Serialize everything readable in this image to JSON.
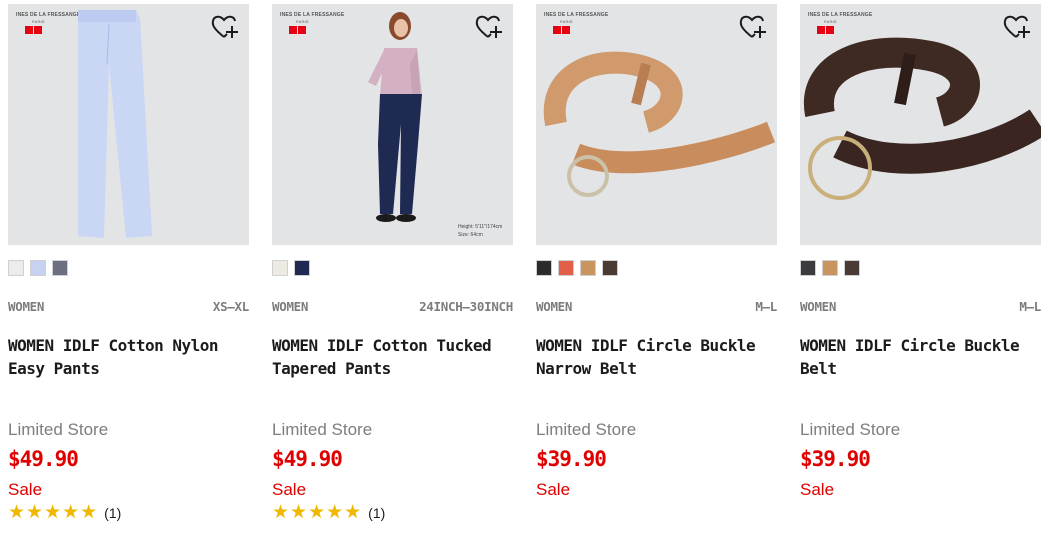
{
  "products": [
    {
      "brand_lines": [
        "INES DE LA FRESSANGE",
        "PARIS"
      ],
      "colors": [
        "#ececea",
        "#c6d2f0",
        "#6b6f80"
      ],
      "category": "WOMEN",
      "size": "XS–XL",
      "name": "WOMEN IDLF Cotton Nylon Easy Pants",
      "store": "Limited Store",
      "price": "$49.90",
      "sale": "Sale",
      "stars": "★★★★★",
      "reviews": "(1)",
      "image": "pants-blue"
    },
    {
      "brand_lines": [
        "INES DE LA FRESSANGE",
        "PARIS"
      ],
      "colors": [
        "#ede9e3",
        "#1e2a52"
      ],
      "category": "WOMEN",
      "size": "24INCH–30INCH",
      "name": "WOMEN IDLF Cotton Tucked Tapered Pants",
      "store": "Limited Store",
      "price": "$49.90",
      "sale": "Sale",
      "stars": "★★★★★",
      "reviews": "(1)",
      "image": "model-navy-pants",
      "model_note": [
        "Height: 5'11\"/174cm",
        "Size: 64cm"
      ]
    },
    {
      "brand_lines": [
        "INES DE LA FRESSANGE",
        "PARIS"
      ],
      "colors": [
        "#2b2b2b",
        "#e2604a",
        "#c8955f",
        "#4a3a34"
      ],
      "category": "WOMEN",
      "size": "M–L",
      "name": "WOMEN IDLF Circle Buckle Narrow Belt",
      "store": "Limited Store",
      "price": "$39.90",
      "sale": "Sale",
      "image": "belt-tan"
    },
    {
      "brand_lines": [
        "INES DE LA FRESSANGE",
        "PARIS"
      ],
      "colors": [
        "#3b3a3c",
        "#c8955f",
        "#4a3a34"
      ],
      "category": "WOMEN",
      "size": "M–L",
      "name": "WOMEN IDLF Circle Buckle Belt",
      "store": "Limited Store",
      "price": "$39.90",
      "sale": "Sale",
      "image": "belt-brown"
    }
  ]
}
